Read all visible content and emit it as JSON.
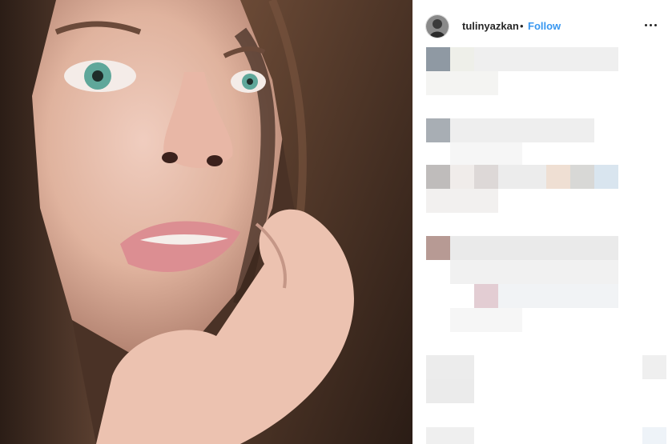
{
  "post": {
    "username": "tulinyazkan",
    "separator": "•",
    "follow_label": "Follow",
    "more_icon": "more-horizontal-icon"
  },
  "photo": {
    "description_icon": "post-photo",
    "skin": "#e3b7a4",
    "hair": "#3d2a20",
    "eyes": "#5fa79a"
  },
  "colors": {
    "accent": "#3897f0",
    "text": "#262626"
  }
}
